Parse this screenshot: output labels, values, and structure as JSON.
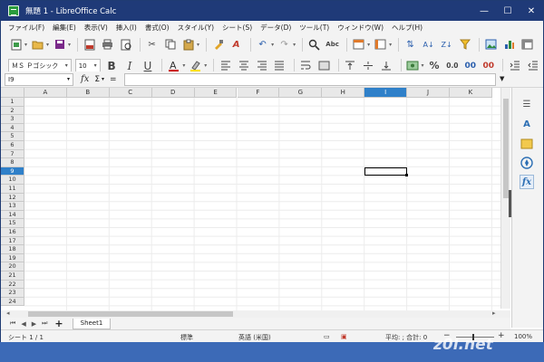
{
  "window": {
    "title": "無題 1 - LibreOffice Calc",
    "minimize_label": "—",
    "maximize_label": "☐",
    "close_label": "✕"
  },
  "menu": [
    "ファイル(F)",
    "編集(E)",
    "表示(V)",
    "挿入(I)",
    "書式(O)",
    "スタイル(Y)",
    "シート(S)",
    "データ(D)",
    "ツール(T)",
    "ウィンドウ(W)",
    "ヘルプ(H)"
  ],
  "toolbar1": {
    "icons": [
      "new-icon",
      "open-icon",
      "save-icon",
      "export-pdf-icon",
      "print-icon",
      "print-preview-icon",
      "cut-icon",
      "copy-icon",
      "paste-icon",
      "clone-format-icon",
      "clear-format-icon",
      "undo-icon",
      "redo-icon",
      "find-replace-icon",
      "spelling-icon",
      "row-icon",
      "column-icon",
      "sort-icon",
      "sort-asc-icon",
      "sort-desc-icon",
      "autofilter-icon",
      "image-icon",
      "chart-icon",
      "pivot-table-icon"
    ]
  },
  "toolbar2": {
    "font_name": "ＭＳ Ｐゴシック",
    "font_size": "10",
    "bold": "B",
    "italic": "I",
    "underline": "U",
    "percent": "%",
    "decimal_zero": "0.0",
    "add_decimal": "00",
    "font_color_accent": "#cc0000",
    "highlight_accent": "#ffe000"
  },
  "formula_bar": {
    "name_box": "I9",
    "fx": "fx",
    "sigma": "Σ",
    "equals": "=",
    "content": ""
  },
  "grid": {
    "columns": [
      "A",
      "B",
      "C",
      "D",
      "E",
      "F",
      "G",
      "H",
      "I",
      "J",
      "K"
    ],
    "rows": [
      "1",
      "2",
      "3",
      "4",
      "5",
      "6",
      "7",
      "8",
      "9",
      "10",
      "11",
      "12",
      "13",
      "14",
      "15",
      "16",
      "17",
      "18",
      "19",
      "20",
      "21",
      "22",
      "23",
      "24"
    ],
    "selected_column": "I",
    "selected_row": "9",
    "selection_color": "#2f80c9"
  },
  "sheet_tabs": {
    "tabs": [
      "Sheet1"
    ],
    "add": "+"
  },
  "statusbar": {
    "sheet_info": "シート 1 / 1",
    "page_style": "標準",
    "language": "英語 (米国)",
    "summary": "平均: ; 合計: 0",
    "zoom": "100%"
  },
  "watermark": "z0l.net"
}
